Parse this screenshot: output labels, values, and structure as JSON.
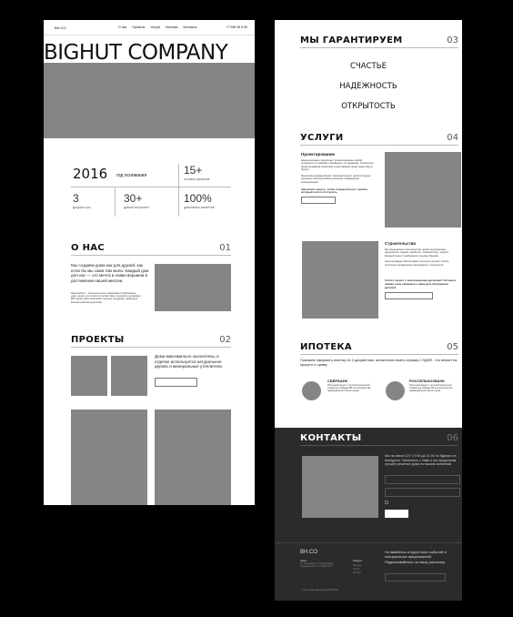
{
  "left": {
    "logo": "BH.CO",
    "nav": [
      "О нас",
      "Проекты",
      "Услуги",
      "Ипотека",
      "Контакты"
    ],
    "phone": "+7 999 45 5 00",
    "title": "BIGHUT COMPANY",
    "stats": [
      {
        "value": "2016",
        "label": "год основания"
      },
      {
        "value": "15+",
        "label": "готовых проектов"
      },
      {
        "value": "3",
        "label": "допуска сро"
      },
      {
        "value": "30+",
        "label": "домов построено"
      },
      {
        "value": "100%",
        "label": "довольных клиентов"
      }
    ],
    "about": {
      "title": "О НАС",
      "num": "01",
      "lead": "Мы создаём дома как для друзей, как если бы мы сами там жили. Каждый дом для нас — это мечта и новая вершина в достижении нашей миссии.",
      "body": "Наша работа — воплощать мечты заказчиков о собственном доме, делать это в срок и в соответствии с проектом и договором. 80% наших работ выполняют опытные сотрудники, гарантируя высокое качество результата."
    },
    "projects": {
      "title": "ПРОЕКТЫ",
      "num": "02",
      "text": "Дома максимально экологичны, в отделке используется натуральное дерево и минеральные утеплители"
    }
  },
  "right": {
    "guarantee": {
      "title": "МЫ ГАРАНТИРУЕМ",
      "num": "03",
      "items": [
        "СЧАСТЬЕ",
        "НАДЕЖНОСТЬ",
        "ОТКРЫТОСТЬ"
      ]
    },
    "services": {
      "title": "УСЛУГИ",
      "num": "04",
      "design": {
        "title": "Проектирование",
        "text": "Наша компания предлагает проектирование любой сложности по эскизам, семейным и по заданиям. Технологии проектирования позволяют в кратчайшие сроки подготовить проект.",
        "text2": "Проектная документация: эскизный проект, архитектурные решения, конструктивные решения, инженерные коммуникации.",
        "cta": "Заполните анкету, чтобы определиться с домом, который хотите построить"
      },
      "build": {
        "title": "Строительство",
        "text": "Мы предлагаем строительство домов из различных материалов: каркас, газобетон, клееный брус, кирпич. Каждый проект подбирается под ваш бюджет.",
        "text2": "Наша команда обеспечивает контроль на всех этапах, используя проверенные материалы и технологии.",
        "cta": "Хотите проект с заполненными деталями? Оставьте заявку и мы свяжемся с вами для обсуждения деталей"
      }
    },
    "mortgage": {
      "title": "ИПОТЕКА",
      "num": "05",
      "intro": "Поможем оформить ипотеку по 2 документам, желательно иметь справку 2 НДФЛ - это влияет на процент и сумму",
      "banks": [
        {
          "name": "СБЕРБАНК",
          "text": "Ипотечный кредит с льготной процентной ставкой для граждан РФ на строительство индивидуального жилого дома."
        },
        {
          "name": "РОССЕЛЬХОЗБАНК",
          "text": "Ипотечный кредит с льготной процентной ставкой для граждан РФ на строительство индивидуального жилого дома."
        }
      ]
    },
    "contacts": {
      "title": "КОНТАКТЫ",
      "num": "06",
      "text": "Мы на связи 12/7 с 9:00 до 21:00 по будням и в выходные. Свяжитесь с нами и мы предложим лучшее решение дома по вашим желаниям"
    },
    "footer": {
      "logo": "BH.CO",
      "address_title": "Адрес",
      "address": "ул. Набережная, 10, Екатеринбург, bighut@yandex.ru, +7 999 45 5 00",
      "menu_title": "Разделы",
      "menu": [
        "Проекты",
        "Услуги",
        "Ипотека"
      ],
      "subscribe": "Оставайтесь в курсе всех событий и специальных предложений. Подписывайтесь на нашу рассылку",
      "copyright": "© Все права защищены 2023 BIGHUT"
    }
  }
}
